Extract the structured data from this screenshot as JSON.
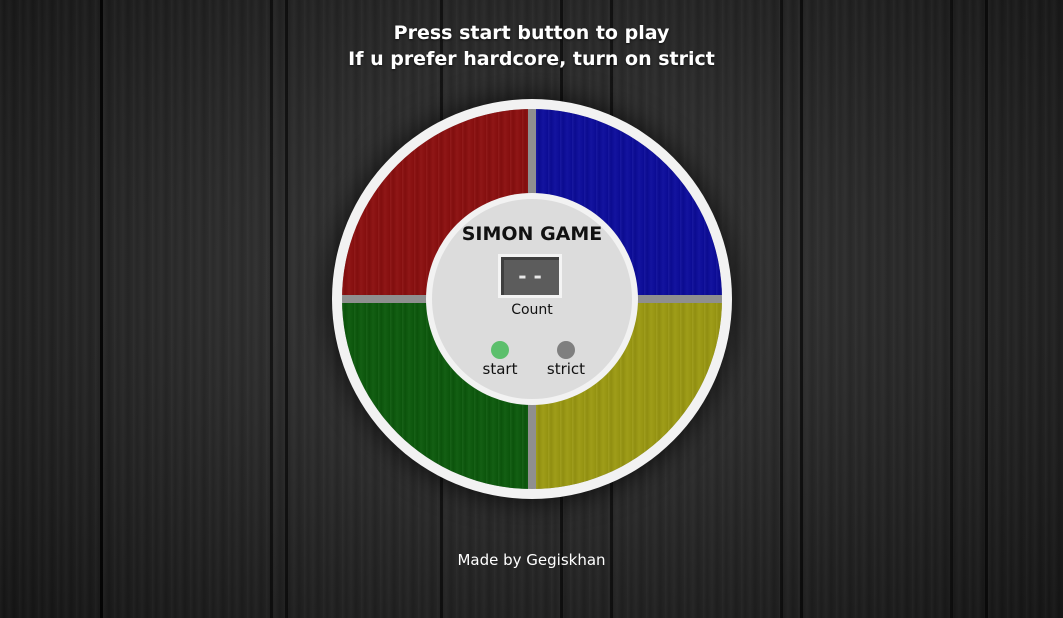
{
  "instructions": {
    "line1": "Press start button to play",
    "line2": "If u prefer hardcore, turn on strict"
  },
  "game": {
    "title": "SIMON GAME",
    "count_display": "- -",
    "count_label": "Count",
    "start_label": "start",
    "strict_label": "strict"
  },
  "colors": {
    "red": "#8c0f0f",
    "blue": "#0c0c9c",
    "green": "#0c5a0c",
    "yellow": "#9c9a12",
    "start_led": "#5cbf6c",
    "strict_led": "#7f7f7f"
  },
  "footer": {
    "credit": "Made by Gegiskhan"
  }
}
